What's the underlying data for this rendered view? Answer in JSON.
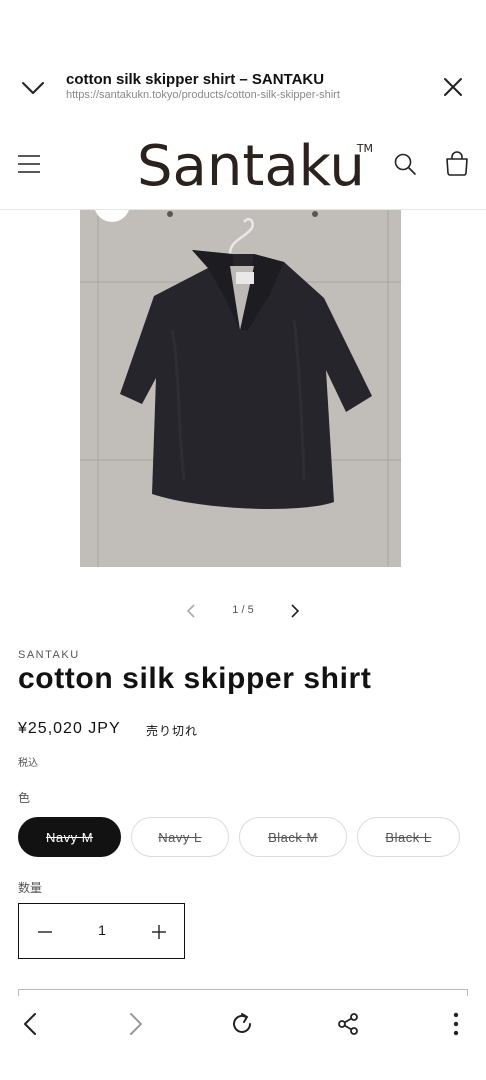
{
  "browser": {
    "page_title": "cotton silk skipper shirt – SANTAKU",
    "url": "https://santakukn.tokyo/products/cotton-silk-skipper-shirt",
    "icons": {
      "collapse": "chevron-down-icon",
      "close": "close-icon",
      "back": "arrow-back-icon",
      "forward": "arrow-forward-icon",
      "reload": "reload-icon",
      "share": "share-icon",
      "more": "more-vertical-icon"
    }
  },
  "site": {
    "logo_text": "Santaku",
    "logo_mark": "TM",
    "icons": {
      "menu": "hamburger-menu-icon",
      "search": "search-icon",
      "cart": "cart-bag-icon"
    }
  },
  "gallery": {
    "counter": "1 / 5",
    "image": "product-photo",
    "colors": {
      "wall": "#bdbab5",
      "shirt": "#26252b"
    }
  },
  "product": {
    "vendor": "SANTAKU",
    "title": "cotton silk skipper shirt",
    "price": "¥25,020 JPY",
    "availability": "売り切れ",
    "tax_note": "税込",
    "color_label": "色",
    "variants": [
      {
        "label": "Navy M",
        "selected": true,
        "sold_out": true
      },
      {
        "label": "Navy L",
        "selected": false,
        "sold_out": true
      },
      {
        "label": "Black M",
        "selected": false,
        "sold_out": true
      },
      {
        "label": "Black L",
        "selected": false,
        "sold_out": true
      }
    ],
    "quantity_label": "数量",
    "quantity": "1"
  },
  "colors": {
    "text": "#121212",
    "selected_variant_bg": "#121212",
    "logo": "#2b211d"
  }
}
